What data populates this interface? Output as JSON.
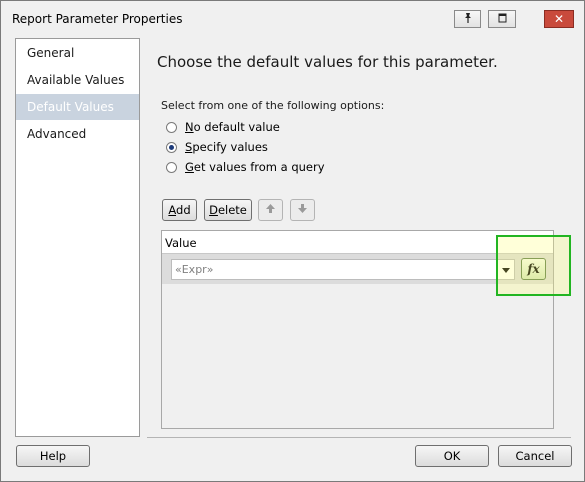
{
  "window": {
    "title": "Report Parameter Properties"
  },
  "titlebar": {
    "pin_icon": "pin-icon",
    "restore_icon": "restore-icon",
    "close_label": "✕"
  },
  "sidebar": {
    "items": [
      {
        "label": "General",
        "active": false
      },
      {
        "label": "Available Values",
        "active": false
      },
      {
        "label": "Default Values",
        "active": true
      },
      {
        "label": "Advanced",
        "active": false
      }
    ]
  },
  "main": {
    "heading": "Choose the default values for this parameter.",
    "subheading": "Select from one of the following options:",
    "options": [
      {
        "accel": "N",
        "rest": "o default value",
        "checked": false
      },
      {
        "accel": "S",
        "rest": "pecify values",
        "checked": true
      },
      {
        "accel": "G",
        "rest": "et values from a query",
        "checked": false
      }
    ],
    "toolbar": {
      "add_accel": "A",
      "add_rest": "dd",
      "delete_accel": "D",
      "delete_rest": "elete"
    },
    "grid": {
      "column_header": "Value",
      "rows": [
        {
          "value_placeholder": "«Expr»",
          "expression_button": "fx"
        }
      ]
    }
  },
  "footer": {
    "help_label": "Help",
    "ok_label": "OK",
    "cancel_label": "Cancel"
  },
  "colors": {
    "highlight_border": "#22b522",
    "sidebar_active": "#c9d3df",
    "close_button": "#c94a3c"
  }
}
